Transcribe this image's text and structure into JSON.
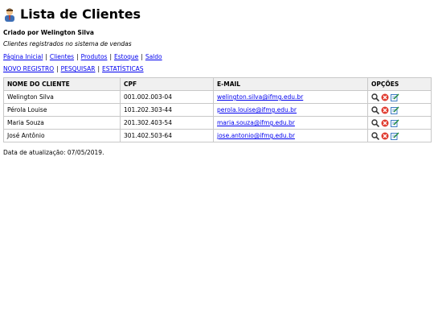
{
  "header": {
    "icon": "person-icon",
    "title": "Lista de Clientes",
    "author": "Criado por Welington Silva",
    "subtitle": "Clientes registrados no sistema de vendas"
  },
  "nav": [
    "Página Inicial",
    "Clientes",
    "Produtos",
    "Estoque",
    "Saldo"
  ],
  "actions": [
    "NOVO REGISTRO",
    "PESQUISAR",
    "ESTATÍSTICAS"
  ],
  "table": {
    "headers": [
      "NOME DO CLIENTE",
      "CPF",
      "E-MAIL",
      "OPÇÕES"
    ],
    "rows": [
      {
        "name": "Welington Silva",
        "cpf": "001.002.003-04",
        "email": "welington.silva@ifmg.edu.br"
      },
      {
        "name": "Pérola Louise",
        "cpf": "101.202.303-44",
        "email": "perola.louise@ifmg.edu.br"
      },
      {
        "name": "Maria Souza",
        "cpf": "201.302.403-54",
        "email": "maria.souza@ifmg.edu.br"
      },
      {
        "name": "José Antônio",
        "cpf": "301.402.503-64",
        "email": "jose.antonio@ifmg.edu.br"
      }
    ],
    "option_icons": [
      "magnifier-icon",
      "delete-icon",
      "edit-icon"
    ]
  },
  "footer": {
    "updated": "Data de atualização: 07/05/2019."
  }
}
